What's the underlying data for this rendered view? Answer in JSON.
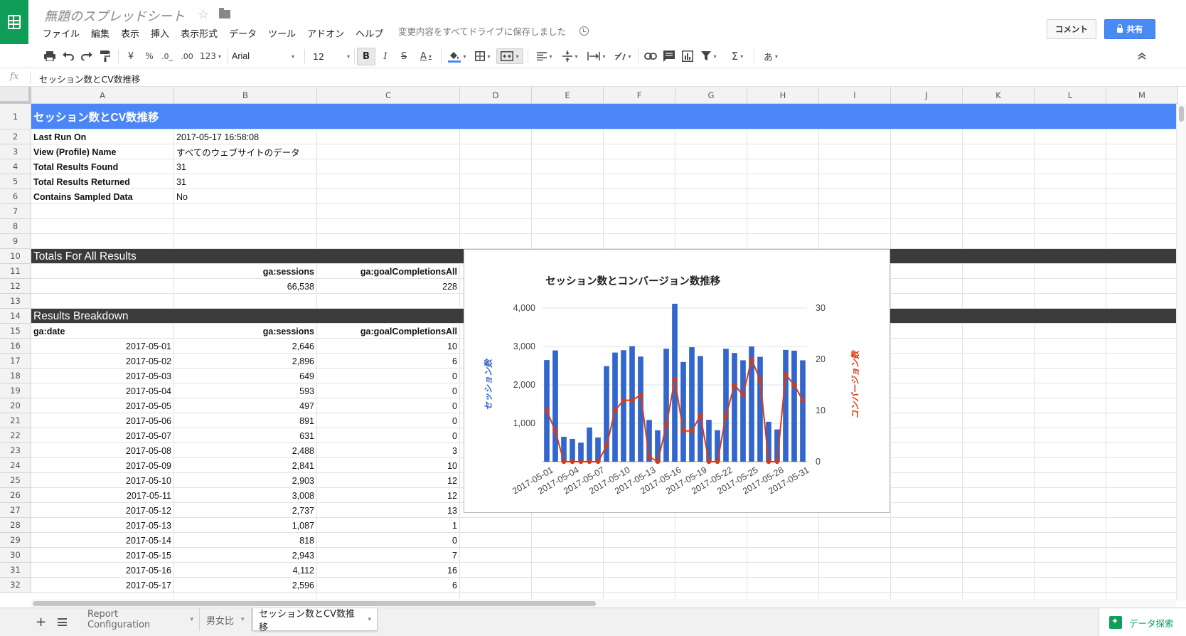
{
  "app": {
    "title": "無題のスプレッドシート",
    "save_status": "変更内容をすべてドライブに保存しました",
    "comment_button": "コメント",
    "share_button": "共有"
  },
  "menu": [
    "ファイル",
    "編集",
    "表示",
    "挿入",
    "表示形式",
    "データ",
    "ツール",
    "アドオン",
    "ヘルプ"
  ],
  "toolbar": {
    "currency": "¥",
    "percent": "%",
    "dec_decrease": ".0_",
    "dec_increase": ".00",
    "more_formats": "123",
    "font": "Arial",
    "font_size": "12",
    "bold": "B",
    "italic": "I",
    "strike": "S",
    "text_color": "A",
    "input_tools": "あ",
    "sum": "Σ"
  },
  "formula_bar": {
    "fx": "fx",
    "value": "セッション数とCV数推移"
  },
  "columns": [
    "A",
    "B",
    "C",
    "D",
    "E",
    "F",
    "G",
    "H",
    "I",
    "J",
    "K",
    "L",
    "M"
  ],
  "rows": [
    "1",
    "2",
    "3",
    "4",
    "5",
    "6",
    "7",
    "8",
    "9",
    "10",
    "11",
    "12",
    "13",
    "14",
    "15",
    "16",
    "17",
    "18",
    "19",
    "20",
    "21",
    "22",
    "23",
    "24",
    "25",
    "26",
    "27",
    "28",
    "29",
    "30",
    "31",
    "32"
  ],
  "sheet": {
    "title": "セッション数とCV数推移",
    "info": [
      {
        "label": "Last Run On",
        "value": "2017-05-17 16:58:08"
      },
      {
        "label": "View (Profile) Name",
        "value": "すべてのウェブサイトのデータ"
      },
      {
        "label": "Total Results Found",
        "value": "31"
      },
      {
        "label": "Total Results Returned",
        "value": "31"
      },
      {
        "label": "Contains Sampled Data",
        "value": "No"
      }
    ],
    "totals_header": "Totals For All Results",
    "totals_cols": [
      "ga:sessions",
      "ga:goalCompletionsAll"
    ],
    "totals_values": [
      "66,538",
      "228"
    ],
    "breakdown_header": "Results Breakdown",
    "breakdown_cols": [
      "ga:date",
      "ga:sessions",
      "ga:goalCompletionsAll"
    ],
    "breakdown_rows": [
      [
        "2017-05-01",
        "2,646",
        "10"
      ],
      [
        "2017-05-02",
        "2,896",
        "6"
      ],
      [
        "2017-05-03",
        "649",
        "0"
      ],
      [
        "2017-05-04",
        "593",
        "0"
      ],
      [
        "2017-05-05",
        "497",
        "0"
      ],
      [
        "2017-05-06",
        "891",
        "0"
      ],
      [
        "2017-05-07",
        "631",
        "0"
      ],
      [
        "2017-05-08",
        "2,488",
        "3"
      ],
      [
        "2017-05-09",
        "2,841",
        "10"
      ],
      [
        "2017-05-10",
        "2,903",
        "12"
      ],
      [
        "2017-05-11",
        "3,008",
        "12"
      ],
      [
        "2017-05-12",
        "2,737",
        "13"
      ],
      [
        "2017-05-13",
        "1,087",
        "1"
      ],
      [
        "2017-05-14",
        "818",
        "0"
      ],
      [
        "2017-05-15",
        "2,943",
        "7"
      ],
      [
        "2017-05-16",
        "4,112",
        "16"
      ],
      [
        "2017-05-17",
        "2,596",
        "6"
      ]
    ]
  },
  "chart_data": {
    "type": "bar",
    "title": "セッション数とコンバージョン数推移",
    "ylabel": "セッション数",
    "y2label": "コンバージョン数",
    "ylim": [
      0,
      4000
    ],
    "y2lim": [
      0,
      30
    ],
    "yticks": [
      "1,000",
      "2,000",
      "3,000",
      "4,000"
    ],
    "y2ticks": [
      "0",
      "10",
      "20",
      "30"
    ],
    "xticks": [
      "2017-05-01",
      "2017-05-04",
      "2017-05-07",
      "2017-05-10",
      "2017-05-13",
      "2017-05-16",
      "2017-05-19",
      "2017-05-22",
      "2017-05-25",
      "2017-05-28",
      "2017-05-31"
    ],
    "x": [
      "2017-05-01",
      "2017-05-02",
      "2017-05-03",
      "2017-05-04",
      "2017-05-05",
      "2017-05-06",
      "2017-05-07",
      "2017-05-08",
      "2017-05-09",
      "2017-05-10",
      "2017-05-11",
      "2017-05-12",
      "2017-05-13",
      "2017-05-14",
      "2017-05-15",
      "2017-05-16",
      "2017-05-17",
      "2017-05-18",
      "2017-05-19",
      "2017-05-20",
      "2017-05-21",
      "2017-05-22",
      "2017-05-23",
      "2017-05-24",
      "2017-05-25",
      "2017-05-26",
      "2017-05-27",
      "2017-05-28",
      "2017-05-29",
      "2017-05-30",
      "2017-05-31"
    ],
    "series": [
      {
        "type": "bar",
        "color": "#3366cc",
        "values": [
          2646,
          2896,
          649,
          593,
          497,
          891,
          631,
          2488,
          2841,
          2903,
          3008,
          2737,
          1087,
          818,
          2943,
          4112,
          2596,
          2980,
          2750,
          1090,
          820,
          2940,
          2830,
          2640,
          3000,
          2730,
          1040,
          840,
          2910,
          2890,
          2640
        ]
      },
      {
        "type": "line",
        "color": "#dc3912",
        "values": [
          10,
          6,
          0,
          0,
          0,
          0,
          0,
          3,
          10,
          12,
          12,
          13,
          1,
          0,
          7,
          16,
          6,
          6,
          9,
          0,
          0,
          9,
          15,
          13,
          20,
          16,
          0,
          0,
          17,
          15,
          12
        ]
      }
    ]
  },
  "tabs": {
    "sheets": [
      "Report Configuration",
      "男女比",
      "セッション数とCV数推移"
    ],
    "explore": "データ探索"
  }
}
